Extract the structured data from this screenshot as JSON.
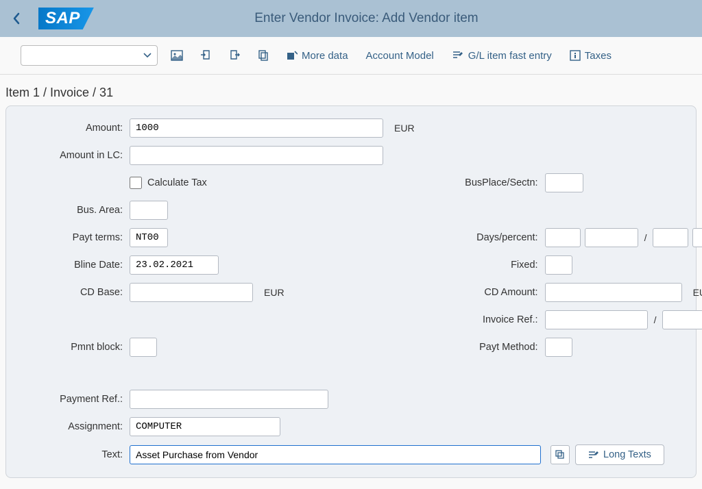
{
  "header": {
    "title": "Enter Vendor Invoice: Add Vendor item",
    "logo_text": "SAP"
  },
  "toolbar": {
    "more_data": "More data",
    "account_model": "Account Model",
    "gl_fast_entry": "G/L item fast entry",
    "taxes": "Taxes"
  },
  "group_title": "Item 1 / Invoice / 31",
  "left": {
    "amount_label": "Amount:",
    "amount_value": "1000",
    "amount_currency": "EUR",
    "amount_lc_label": "Amount in LC:",
    "amount_lc_value": "",
    "calc_tax_label": "Calculate Tax",
    "bus_area_label": "Bus. Area:",
    "bus_area_value": "",
    "payt_terms_label": "Payt terms:",
    "payt_terms_value": "NT00",
    "bline_date_label": "Bline Date:",
    "bline_date_value": "23.02.2021",
    "cd_base_label": "CD Base:",
    "cd_base_value": "",
    "cd_base_currency": "EUR",
    "pmnt_block_label": "Pmnt block:",
    "pmnt_block_value": "",
    "payment_ref_label": "Payment Ref.:",
    "payment_ref_value": "",
    "assignment_label": "Assignment:",
    "assignment_value": "COMPUTER",
    "text_label": "Text:",
    "text_value": "Asset Purchase from Vendor"
  },
  "right": {
    "busplace_label": "BusPlace/Sectn:",
    "busplace_value": "",
    "days_percent_label": "Days/percent:",
    "fixed_label": "Fixed:",
    "fixed_value": "",
    "cd_amount_label": "CD Amount:",
    "cd_amount_value": "",
    "cd_amount_currency": "EUR",
    "invoice_ref_label": "Invoice Ref.:",
    "payt_method_label": "Payt Method:",
    "payt_method_value": ""
  },
  "buttons": {
    "long_texts": "Long Texts"
  }
}
